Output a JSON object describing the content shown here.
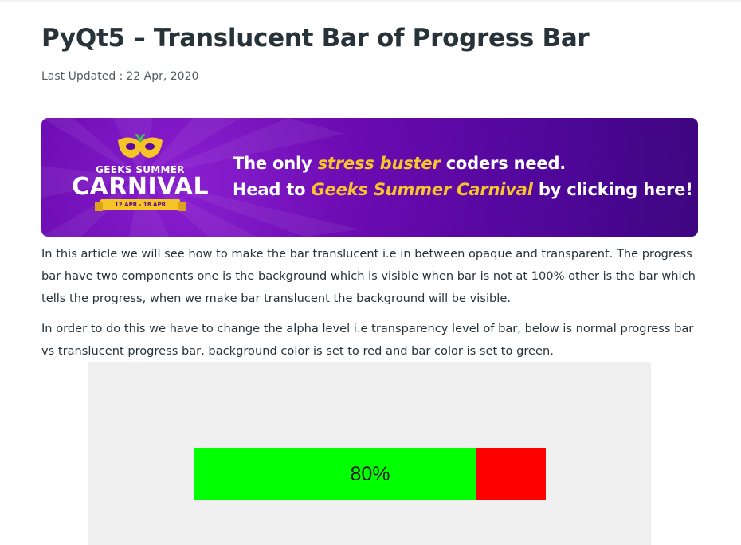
{
  "article": {
    "title": "PyQt5 – Translucent Bar of Progress Bar",
    "updated_label": "Last Updated :",
    "updated_date": "22 Apr, 2020"
  },
  "banner": {
    "logo_top": "GEEKS SUMMER",
    "logo_main": "CARNIVAL",
    "logo_dates": "12 APR - 18 APR",
    "line1_before": "The only ",
    "line1_highlight": "stress buster",
    "line1_after": " coders need.",
    "line2_before": "Head to ",
    "line2_highlight": "Geeks Summer Carnival",
    "line2_after": " by clicking here!",
    "colors": {
      "background": "#5a0aa3",
      "highlight": "#f7c52b",
      "text": "#ffffff"
    }
  },
  "paragraphs": [
    "In this article we will see how to make the bar translucent i.e in between opaque and transparent. The progress bar have two components one is the background which is visible when bar is not at 100% other is the bar which tells the progress, when we make bar translucent the background will be visible.",
    "In order to do this we have to change the alpha level i.e transparency level of bar, below is normal progress bar vs translucent progress bar, background color is set to red and bar color is set to green."
  ],
  "figure": {
    "progress_value": 80,
    "progress_text": "80%",
    "bar_color": "#00ff00",
    "background_color": "#ff0000"
  }
}
